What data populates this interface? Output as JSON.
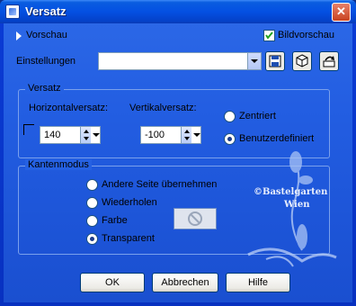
{
  "window": {
    "title": "Versatz",
    "close_glyph": "✕"
  },
  "preview": {
    "toggle_label": "Vorschau",
    "checkbox_label": "Bildvorschau",
    "checked": true
  },
  "settings": {
    "label": "Einstellungen",
    "value": ""
  },
  "offset_group": {
    "title": "Versatz",
    "horizontal_label": "Horizontalversatz:",
    "horizontal_value": "140",
    "vertical_label": "Vertikalversatz:",
    "vertical_value": "-100",
    "options": [
      {
        "label": "Zentriert",
        "selected": false
      },
      {
        "label": "Benutzerdefiniert",
        "selected": true
      }
    ]
  },
  "edge_group": {
    "title": "Kantenmodus",
    "options": [
      {
        "label": "Andere Seite übernehmen",
        "selected": false
      },
      {
        "label": "Wiederholen",
        "selected": false
      },
      {
        "label": "Farbe",
        "selected": false
      },
      {
        "label": "Transparent",
        "selected": true
      }
    ]
  },
  "watermark": {
    "line1": "©Bastelgarten",
    "line2": "Wien"
  },
  "buttons": {
    "ok": "OK",
    "cancel": "Abbrechen",
    "help": "Hilfe"
  },
  "icons": [
    "window-icon",
    "save-icon",
    "cube-icon",
    "reset-icon",
    "no-color-icon",
    "expand-triangle-icon"
  ],
  "colors": {
    "titlebar": "#0450e2",
    "client_bg": "#235ee2",
    "close": "#c9431f",
    "check_green": "#21a121"
  }
}
